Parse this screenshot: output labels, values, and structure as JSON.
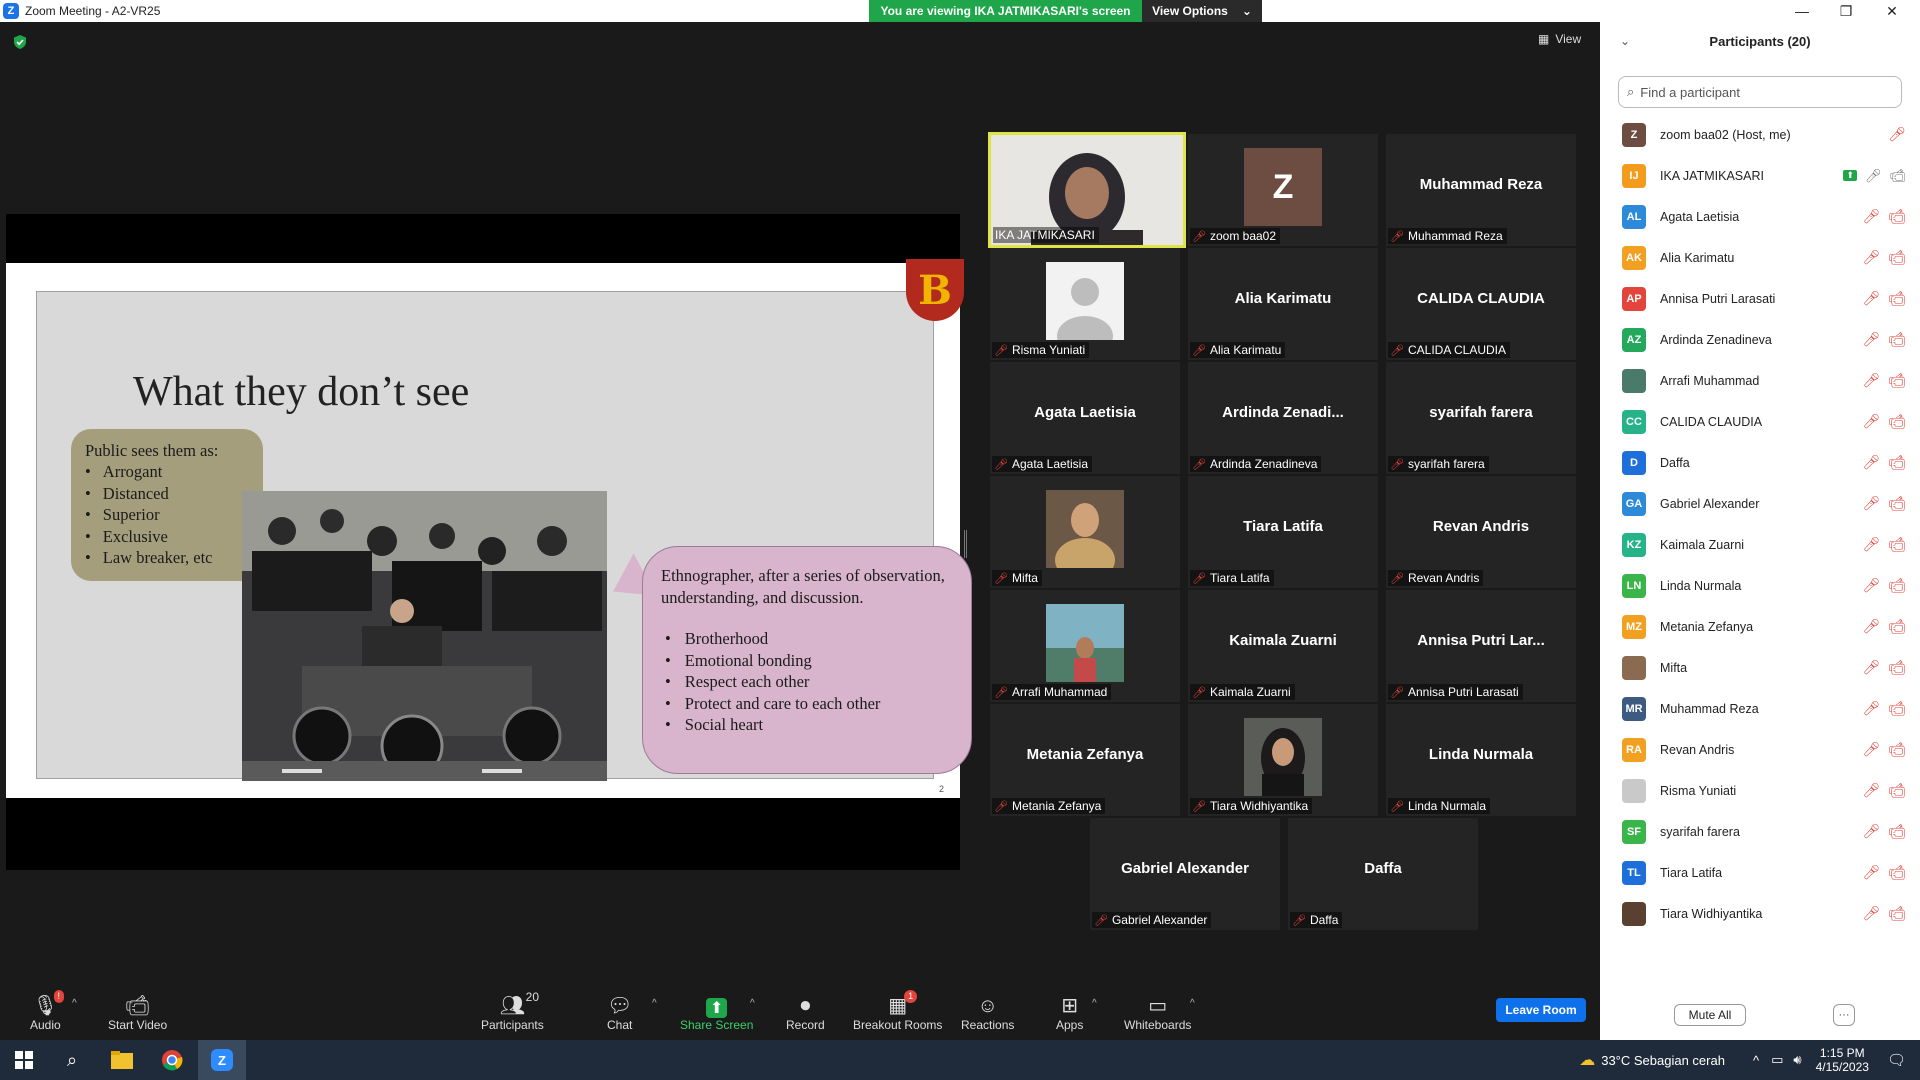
{
  "window": {
    "title": "Zoom Meeting - A2-VR25",
    "logo": "Z"
  },
  "banner": {
    "viewing": "You are viewing IKA JATMIKASARI's screen",
    "view_options": "View Options"
  },
  "view_button": "View",
  "slide": {
    "logo_letter": "B",
    "title": "What they don’t see",
    "bubble1_heading": "Public sees them as:",
    "bubble1_items": [
      "Arrogant",
      "Distanced",
      "Superior",
      "Exclusive",
      "Law breaker, etc"
    ],
    "bubble2_text": "Ethnographer, after a series of observation, understanding, and discussion.",
    "bubble2_items": [
      "Brotherhood",
      "Emotional bonding",
      "Respect each other",
      "Protect and care to each other",
      "Social heart"
    ],
    "page_number": "2"
  },
  "tiles": [
    {
      "big": "",
      "label": "IKA JATMIKASARI",
      "muted": false
    },
    {
      "big": "Z",
      "label": "zoom baa02",
      "muted": true
    },
    {
      "big": "Muhammad Reza",
      "label": "Muhammad Reza",
      "muted": true
    },
    {
      "big": "",
      "label": "Risma Yuniati",
      "muted": true
    },
    {
      "big": "Alia Karimatu",
      "label": "Alia Karimatu",
      "muted": true
    },
    {
      "big": "CALIDA CLAUDIA",
      "label": "CALIDA CLAUDIA",
      "muted": true
    },
    {
      "big": "Agata Laetisia",
      "label": "Agata Laetisia",
      "muted": true
    },
    {
      "big": "Ardinda  Zenadi...",
      "label": "Ardinda Zenadineva",
      "muted": true
    },
    {
      "big": "syarifah farera",
      "label": "syarifah farera",
      "muted": true
    },
    {
      "big": "",
      "label": "Mifta",
      "muted": true
    },
    {
      "big": "Tiara Latifa",
      "label": "Tiara Latifa",
      "muted": true
    },
    {
      "big": "Revan Andris",
      "label": "Revan Andris",
      "muted": true
    },
    {
      "big": "",
      "label": "Arrafi Muhammad",
      "muted": true
    },
    {
      "big": "Kaimala Zuarni",
      "label": "Kaimala Zuarni",
      "muted": true
    },
    {
      "big": "Annisa Putri Lar...",
      "label": "Annisa Putri Larasati",
      "muted": true
    },
    {
      "big": "Metania Zefanya",
      "label": "Metania Zefanya",
      "muted": true
    },
    {
      "big": "",
      "label": "Tiara Widhiyantika",
      "muted": true
    },
    {
      "big": "Linda Nurmala",
      "label": "Linda Nurmala",
      "muted": true
    },
    {
      "big": "Gabriel Alexander",
      "label": "Gabriel Alexander",
      "muted": true
    },
    {
      "big": "Daffa",
      "label": "Daffa",
      "muted": true
    }
  ],
  "panel": {
    "title": "Participants (20)",
    "search_placeholder": "Find a participant",
    "participants": [
      {
        "initials": "Z",
        "name": "zoom baa02 (Host, me)",
        "color": "#6d4c41"
      },
      {
        "initials": "IJ",
        "name": "IKA JATMIKASARI",
        "color": "#f29b1d"
      },
      {
        "initials": "AL",
        "name": "Agata Laetisia",
        "color": "#2d8ad8"
      },
      {
        "initials": "AK",
        "name": "Alia Karimatu",
        "color": "#f2a021"
      },
      {
        "initials": "AP",
        "name": "Annisa Putri Larasati",
        "color": "#e2453c"
      },
      {
        "initials": "AZ",
        "name": "Ardinda Zenadineva",
        "color": "#24a85c"
      },
      {
        "initials": "",
        "name": "Arrafi Muhammad",
        "color": "#4a7a6a"
      },
      {
        "initials": "CC",
        "name": "CALIDA CLAUDIA",
        "color": "#26b38a"
      },
      {
        "initials": "D",
        "name": "Daffa",
        "color": "#1e6fd9"
      },
      {
        "initials": "GA",
        "name": "Gabriel Alexander",
        "color": "#2d8ad8"
      },
      {
        "initials": "KZ",
        "name": "Kaimala Zuarni",
        "color": "#26b38a"
      },
      {
        "initials": "LN",
        "name": "Linda Nurmala",
        "color": "#3ab54a"
      },
      {
        "initials": "MZ",
        "name": "Metania Zefanya",
        "color": "#f2a021"
      },
      {
        "initials": "",
        "name": "Mifta",
        "color": "#8a6a50"
      },
      {
        "initials": "MR",
        "name": "Muhammad Reza",
        "color": "#3d5a80"
      },
      {
        "initials": "RA",
        "name": "Revan Andris",
        "color": "#f2a021"
      },
      {
        "initials": "",
        "name": "Risma Yuniati",
        "color": "#c9c9c9"
      },
      {
        "initials": "SF",
        "name": "syarifah farera",
        "color": "#3ab54a"
      },
      {
        "initials": "TL",
        "name": "Tiara Latifa",
        "color": "#1e6fd9"
      },
      {
        "initials": "",
        "name": "Tiara Widhiyantika",
        "color": "#5a4030"
      }
    ],
    "mute_all": "Mute All",
    "more": "···"
  },
  "toolbar": {
    "audio": "Audio",
    "start_video": "Start Video",
    "participants": "Participants",
    "participants_count": "20",
    "chat": "Chat",
    "share_screen": "Share Screen",
    "record": "Record",
    "breakout": "Breakout Rooms",
    "breakout_badge": "1",
    "reactions": "Reactions",
    "apps": "Apps",
    "whiteboards": "Whiteboards",
    "leave": "Leave Room",
    "audio_badge": "!"
  },
  "taskbar": {
    "weather": "33°C  Sebagian cerah",
    "time": "1:15 PM",
    "date": "4/15/2023"
  },
  "colors": {
    "accent_green": "#1fa64a",
    "mute_red": "#e2453c",
    "leave_blue": "#0e71eb",
    "active_speaker": "#dfe546"
  }
}
